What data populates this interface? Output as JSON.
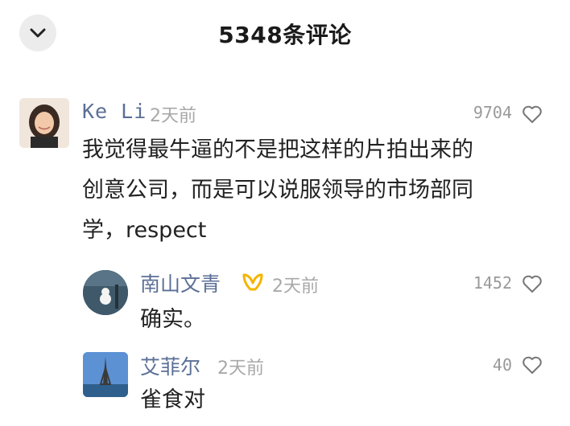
{
  "header": {
    "title": "5348条评论",
    "back_icon": "chevron-down-icon"
  },
  "comments": [
    {
      "user": "Ke Li",
      "time": "2天前",
      "likes": "9704",
      "text": "我觉得最牛逼的不是把这样的片拍出来的创意公司，而是可以说服领导的市场部同学，respect"
    }
  ],
  "replies": [
    {
      "user": "南山文青",
      "time": "2天前",
      "likes": "1452",
      "text": "确实。",
      "badge": "vip-badge-icon"
    },
    {
      "user": "艾菲尔",
      "time": "2天前",
      "likes": "40",
      "text": "雀食对"
    }
  ],
  "colors": {
    "username": "#5b6f96",
    "meta": "#a8a8a8",
    "badge": "#f5b400"
  }
}
